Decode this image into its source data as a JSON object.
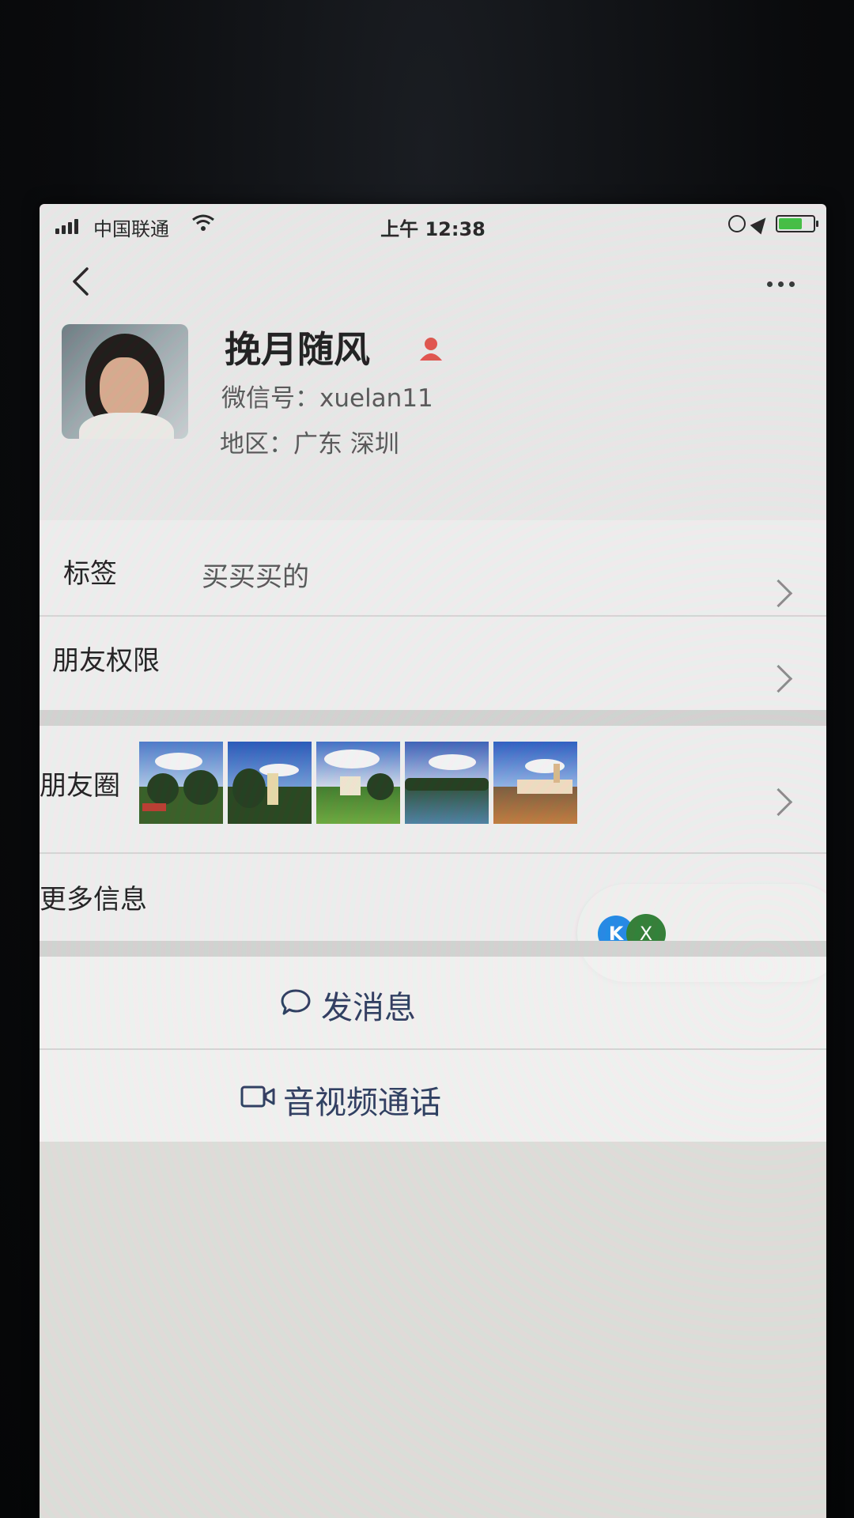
{
  "status_bar": {
    "carrier": "中国联通",
    "time": "上午 12:38",
    "battery_level": 0.7,
    "battery_color": "#3fbf3f"
  },
  "nav": {
    "back_icon": "chevron-left-icon",
    "more_icon": "more-dots-icon"
  },
  "profile": {
    "name": "挽月随风",
    "gender_icon": "person-icon",
    "gender_icon_color": "#e0524a",
    "wechat_id": "微信号：xuelan11",
    "region": "地区：广东 深圳"
  },
  "rows": {
    "tags": {
      "label": "标签",
      "value": "买买买的"
    },
    "friend_permissions": {
      "label": "朋友权限"
    },
    "moments": {
      "label": "朋友圈",
      "photo_count": 5
    },
    "more_info": {
      "label": "更多信息"
    }
  },
  "floating_window": {
    "app_icon_text": "K",
    "close_text": "X"
  },
  "actions": {
    "message": {
      "label": "发消息",
      "icon": "chat-bubble-icon"
    },
    "call": {
      "label": "音视频通话",
      "icon": "video-camera-icon"
    }
  },
  "colors": {
    "action_text": "#2a3a5c",
    "screen_bg": "#e9e9e7"
  }
}
